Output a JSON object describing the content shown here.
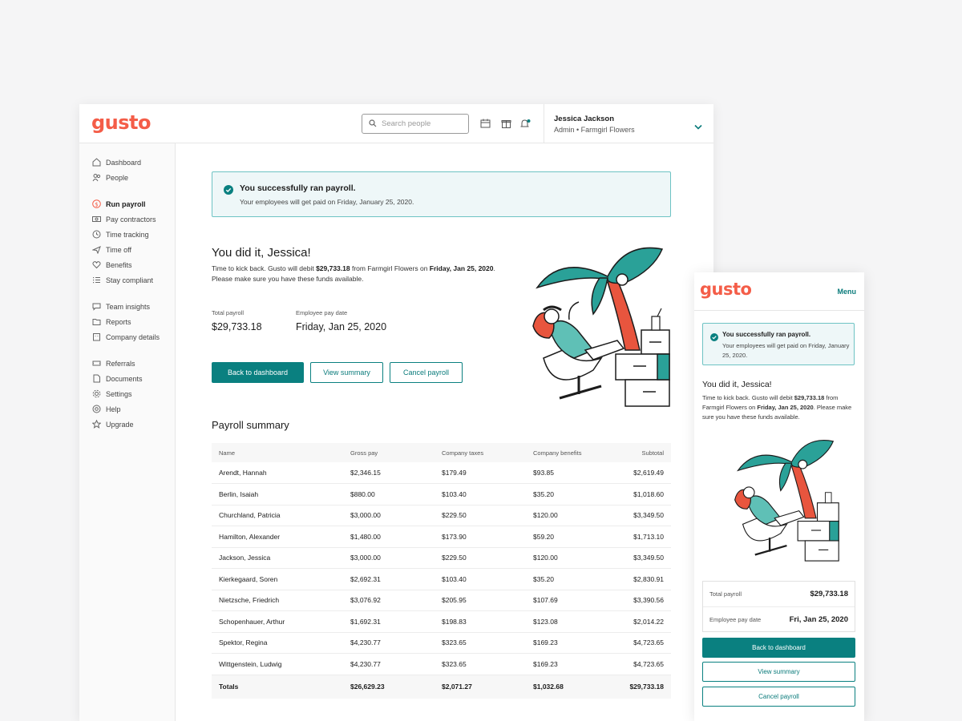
{
  "desktop": {
    "logo": "gusto",
    "search": {
      "placeholder": "Search people"
    },
    "user": {
      "name": "Jessica Jackson",
      "role": "Admin • Farmgirl Flowers"
    },
    "sidebar": {
      "groups": [
        [
          {
            "label": "Dashboard",
            "icon": "home-icon"
          },
          {
            "label": "People",
            "icon": "people-icon"
          }
        ],
        [
          {
            "label": "Run payroll",
            "icon": "dollar-icon",
            "active": true
          },
          {
            "label": "Pay contractors",
            "icon": "money-icon"
          },
          {
            "label": "Time tracking",
            "icon": "clock-icon"
          },
          {
            "label": "Time off",
            "icon": "plane-icon"
          },
          {
            "label": "Benefits",
            "icon": "heart-icon"
          },
          {
            "label": "Stay compliant",
            "icon": "checklist-icon"
          }
        ],
        [
          {
            "label": "Team insights",
            "icon": "chat-icon"
          },
          {
            "label": "Reports",
            "icon": "folder-icon"
          },
          {
            "label": "Company details",
            "icon": "building-icon"
          }
        ],
        [
          {
            "label": "Referrals",
            "icon": "ticket-icon"
          },
          {
            "label": "Documents",
            "icon": "document-icon"
          },
          {
            "label": "Settings",
            "icon": "gear-icon"
          },
          {
            "label": "Help",
            "icon": "help-icon"
          },
          {
            "label": "Upgrade",
            "icon": "star-icon"
          }
        ]
      ]
    },
    "alert": {
      "title": "You successfully ran payroll.",
      "subtitle": "Your employees will get paid on Friday, January 25, 2020."
    },
    "hero": {
      "title": "You did it, Jessica!",
      "body_prefix": "Time to kick back. Gusto will debit ",
      "amount": "$29,733.18",
      "body_mid": " from Farmgirl Flowers on ",
      "date": "Friday, Jan 25, 2020",
      "body_suffix": ". Please make sure you have these funds available."
    },
    "stats": {
      "total_label": "Total payroll",
      "total_value": "$29,733.18",
      "date_label": "Employee pay date",
      "date_value": "Friday, Jan 25, 2020"
    },
    "buttons": {
      "back": "Back to dashboard",
      "view": "View summary",
      "cancel": "Cancel payroll"
    },
    "summary": {
      "title": "Payroll summary",
      "headers": [
        "Name",
        "Gross pay",
        "Company taxes",
        "Company benefits",
        "Subtotal"
      ],
      "rows": [
        [
          "Arendt, Hannah",
          "$2,346.15",
          "$179.49",
          "$93.85",
          "$2,619.49"
        ],
        [
          "Berlin, Isaiah",
          "$880.00",
          "$103.40",
          "$35.20",
          "$1,018.60"
        ],
        [
          "Churchland, Patricia",
          "$3,000.00",
          "$229.50",
          "$120.00",
          "$3,349.50"
        ],
        [
          "Hamilton, Alexander",
          "$1,480.00",
          "$173.90",
          "$59.20",
          "$1,713.10"
        ],
        [
          "Jackson, Jessica",
          "$3,000.00",
          "$229.50",
          "$120.00",
          "$3,349.50"
        ],
        [
          "Kierkegaard, Soren",
          "$2,692.31",
          "$103.40",
          "$35.20",
          "$2,830.91"
        ],
        [
          "Nietzsche, Friedrich",
          "$3,076.92",
          "$205.95",
          "$107.69",
          "$3,390.56"
        ],
        [
          "Schopenhauer, Arthur",
          "$1,692.31",
          "$198.83",
          "$123.08",
          "$2,014.22"
        ],
        [
          "Spektor, Regina",
          "$4,230.77",
          "$323.65",
          "$169.23",
          "$4,723.65"
        ],
        [
          "Wittgenstein, Ludwig",
          "$4,230.77",
          "$323.65",
          "$169.23",
          "$4,723.65"
        ]
      ],
      "totals": [
        "Totals",
        "$26,629.23",
        "$2,071.27",
        "$1,032.68",
        "$29,733.18"
      ]
    }
  },
  "mobile": {
    "logo": "gusto",
    "menu": "Menu",
    "alert": {
      "title": "You successfully ran payroll.",
      "subtitle": "Your employees will get paid on Friday, January 25, 2020."
    },
    "hero": {
      "title": "You did it, Jessica!",
      "body_prefix": "Time to kick back. Gusto will debit ",
      "amount": "$29,733.18",
      "body_mid": " from Farmgirl Flowers on ",
      "date": "Friday, Jan 25, 2020",
      "body_suffix": ". Please make sure you have these funds available."
    },
    "stats": {
      "total_label": "Total payroll",
      "total_value": "$29,733.18",
      "date_label": "Employee pay date",
      "date_value": "Fri, Jan 25, 2020"
    },
    "buttons": {
      "back": "Back to dashboard",
      "view": "View summary",
      "cancel": "Cancel payroll"
    }
  },
  "colors": {
    "brand": "#f45d48",
    "accent": "#0a8080",
    "alert_bg": "#eef7f8",
    "alert_border": "#6ec3c4"
  }
}
